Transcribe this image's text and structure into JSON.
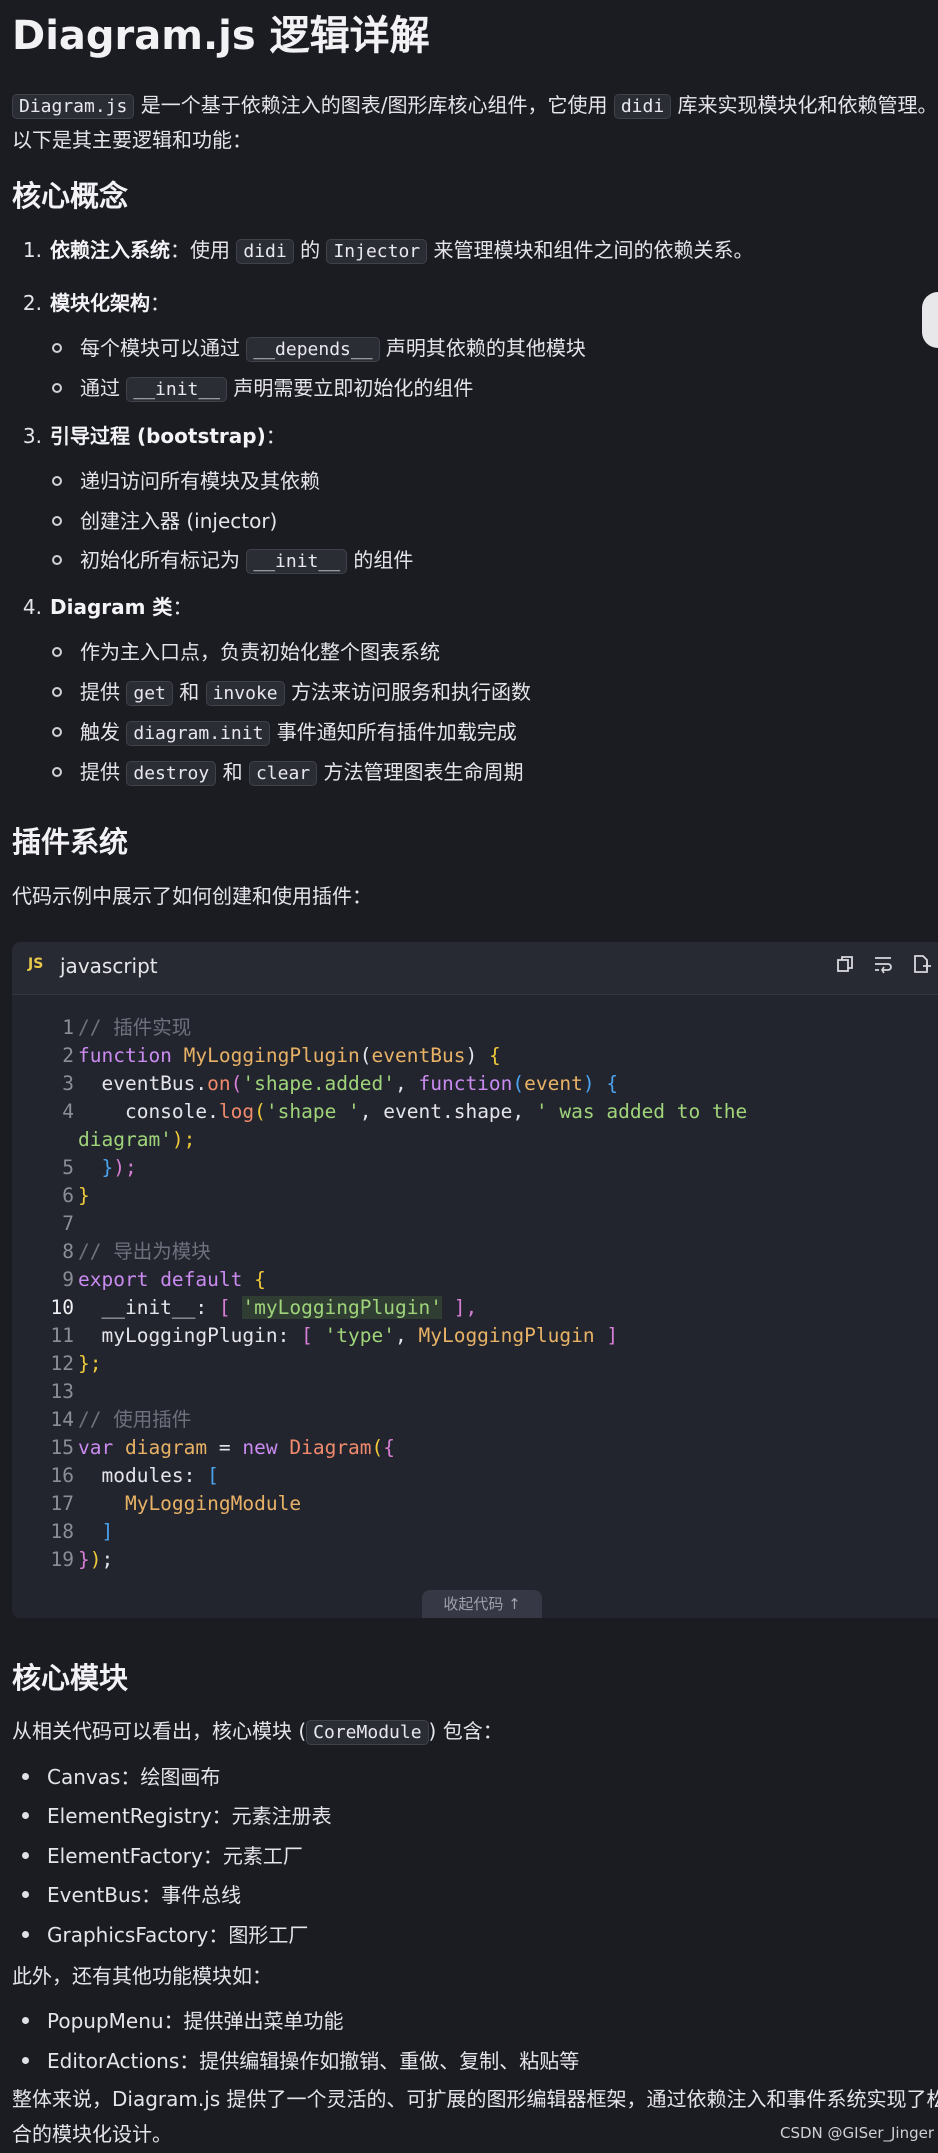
{
  "title": "Diagram.js 逻辑详解",
  "intro": {
    "code1": "Diagram.js",
    "text1": " 是一个基于依赖注入的图表/图形库核心组件，它使用 ",
    "code2": "didi",
    "text2": " 库来实现模块化和依赖管理。",
    "line2": "以下是其主要逻辑和功能："
  },
  "section1": {
    "heading": "核心概念",
    "item1": {
      "num": "1.",
      "bold": "依赖注入系统",
      "t1": "：使用 ",
      "c1": "didi",
      "t2": " 的 ",
      "c2": "Injector",
      "t3": " 来管理模块和组件之间的依赖关系。"
    },
    "item2": {
      "num": "2.",
      "bold": "模块化架构",
      "t1": "：",
      "sub1": {
        "t1": "每个模块可以通过 ",
        "c1": "__depends__",
        "t2": " 声明其依赖的其他模块"
      },
      "sub2": {
        "t1": "通过 ",
        "c1": "__init__",
        "t2": " 声明需要立即初始化的组件"
      }
    },
    "item3": {
      "num": "3.",
      "bold": "引导过程 (bootstrap)",
      "t1": "：",
      "sub1": "递归访问所有模块及其依赖",
      "sub2": "创建注入器 (injector)",
      "sub3": {
        "t1": "初始化所有标记为 ",
        "c1": "__init__",
        "t2": " 的组件"
      }
    },
    "item4": {
      "num": "4.",
      "bold": "Diagram 类",
      "t1": "：",
      "sub1": "作为主入口点，负责初始化整个图表系统",
      "sub2": {
        "t1": "提供 ",
        "c1": "get",
        "t2": " 和 ",
        "c2": "invoke",
        "t3": " 方法来访问服务和执行函数"
      },
      "sub3": {
        "t1": "触发 ",
        "c1": "diagram.init",
        "t2": " 事件通知所有插件加载完成"
      },
      "sub4": {
        "t1": "提供 ",
        "c1": "destroy",
        "t2": " 和 ",
        "c2": "clear",
        "t3": " 方法管理图表生命周期"
      }
    }
  },
  "section2": {
    "heading": "插件系统",
    "text": "代码示例中展示了如何创建和使用插件："
  },
  "codeblock": {
    "badge": "JS",
    "lang": "javascript",
    "collapse": "收起代码 ↑",
    "line_numbers": [
      "1",
      "2",
      "3",
      "4",
      "",
      "5",
      "6",
      "7",
      "8",
      "9",
      "10",
      "11",
      "12",
      "13",
      "14",
      "15",
      "16",
      "17",
      "18",
      "19"
    ],
    "l1": "// 插件实现",
    "l2a": "function ",
    "l2b": "MyLoggingPlugin",
    "l2c": "(",
    "l2d": "eventBus",
    "l2e": ") ",
    "l2f": "{",
    "l3a": "  eventBus.",
    "l3b": "on",
    "l3c": "(",
    "l3d": "'shape.added'",
    "l3e": ", ",
    "l3f": "function",
    "l3g": "(",
    "l3h": "event",
    "l3i": ") ",
    "l3j": "{",
    "l4a": "    console.",
    "l4b": "log",
    "l4c": "(",
    "l4d": "'shape '",
    "l4e": ", event.shape, ",
    "l4f": "' was added to the",
    "l4g": "diagram'",
    "l4h": ");",
    "l5a": "  }",
    "l5b": ");",
    "l6": "}",
    "l8": "// 导出为模块",
    "l9a": "export ",
    "l9b": "default ",
    "l9c": "{",
    "l10a": "  __init__: ",
    "l10b": "[ ",
    "l10c": "'myLoggingPlugin'",
    "l10d": " ],",
    "l11a": "  myLoggingPlugin: ",
    "l11b": "[ ",
    "l11c": "'type'",
    "l11d": ", ",
    "l11e": "MyLoggingPlugin",
    "l11f": " ]",
    "l12": "};",
    "l14": "// 使用插件",
    "l15a": "var ",
    "l15b": "diagram",
    "l15c": " = ",
    "l15d": "new ",
    "l15e": "Diagram",
    "l15f": "(",
    "l15g": "{",
    "l16a": "  modules: ",
    "l16b": "[",
    "l17": "    MyLoggingModule",
    "l18": "  ]",
    "l19a": "}",
    "l19b": ")",
    "l19c": ";"
  },
  "section3": {
    "heading": "核心模块",
    "intro": {
      "t1": "从相关代码可以看出，核心模块 (",
      "c1": "CoreModule",
      "t2": ") 包含："
    },
    "items": [
      "Canvas：绘图画布",
      "ElementRegistry：元素注册表",
      "ElementFactory：元素工厂",
      "EventBus：事件总线",
      "GraphicsFactory：图形工厂"
    ],
    "more": "此外，还有其他功能模块如：",
    "items2": [
      "PopupMenu：提供弹出菜单功能",
      "EditorActions：提供编辑操作如撤销、重做、复制、粘贴等"
    ],
    "summary1": "整体来说，Diagram.js 提供了一个灵活的、可扩展的图形编辑器框架，通过依赖注入和事件系统实现了松耦",
    "summary2": "合的模块化设计。"
  },
  "watermark": "CSDN @GISer_Jinger"
}
